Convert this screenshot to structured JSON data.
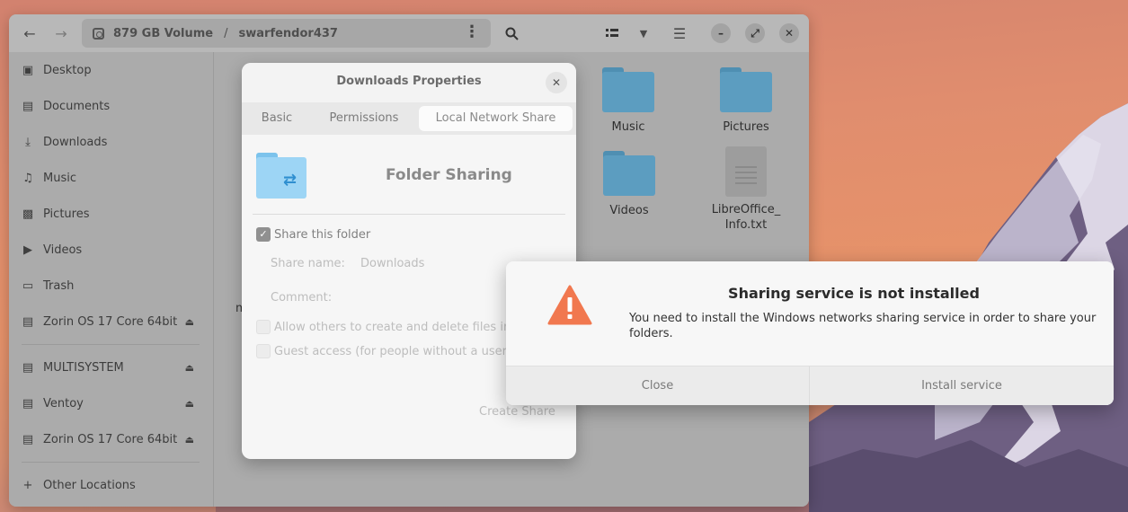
{
  "file_manager": {
    "path": {
      "volume": "879 GB Volume",
      "separator": "/",
      "folder": "swarfendor437"
    },
    "sidebar": [
      {
        "label": "Desktop",
        "icon": "desktop-icon"
      },
      {
        "label": "Documents",
        "icon": "documents-icon"
      },
      {
        "label": "Downloads",
        "icon": "downloads-icon"
      },
      {
        "label": "Music",
        "icon": "music-icon"
      },
      {
        "label": "Pictures",
        "icon": "pictures-icon"
      },
      {
        "label": "Videos",
        "icon": "videos-icon"
      },
      {
        "label": "Trash",
        "icon": "trash-icon"
      },
      {
        "label": "Zorin OS 17 Core 64bit",
        "icon": "drive-icon",
        "eject": true
      },
      {
        "label": "MULTISYSTEM",
        "icon": "drive-icon",
        "eject": true
      },
      {
        "label": "Ventoy",
        "icon": "drive-icon",
        "eject": true
      },
      {
        "label": "Zorin OS 17 Core 64bit",
        "icon": "drive-icon",
        "eject": true
      },
      {
        "label": "Other Locations",
        "icon": "plus-icon"
      }
    ],
    "items": [
      {
        "label": "Music",
        "type": "folder"
      },
      {
        "label": "Pictures",
        "type": "folder"
      },
      {
        "label": "Videos",
        "type": "folder"
      },
      {
        "label_line1": "LibreOffice_",
        "label_line2": "Info.txt",
        "type": "text-file"
      }
    ],
    "stray_text": "m"
  },
  "properties_dialog": {
    "title": "Downloads Properties",
    "close_label": "✕",
    "tabs": [
      "Basic",
      "Permissions",
      "Local Network Share"
    ],
    "active_tab": "Local Network Share",
    "section_title": "Folder Sharing",
    "share_folder_label": "Share this folder",
    "share_folder_checked": true,
    "share_name_label": "Share name:",
    "share_name_value": "Downloads",
    "comment_label": "Comment:",
    "allow_others_label": "Allow others to create and delete files in t",
    "guest_access_label": "Guest access (for people without a user",
    "create_share_label": "Create Share"
  },
  "alert_dialog": {
    "title": "Sharing service is not installed",
    "message": "You need to install the Windows networks sharing service in order to share your folders.",
    "buttons": {
      "close": "Close",
      "install": "Install service"
    },
    "icon": "warning-icon",
    "icon_color": "#f1784f"
  }
}
